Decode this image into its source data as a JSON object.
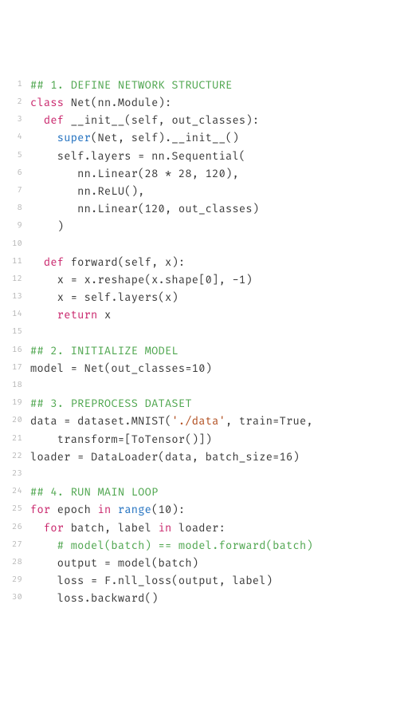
{
  "code": {
    "lines": [
      {
        "num": "1",
        "tokens": [
          {
            "cls": "tok-comment",
            "t": "## 1. DEFINE NETWORK STRUCTURE"
          }
        ]
      },
      {
        "num": "2",
        "tokens": [
          {
            "cls": "tok-keyword",
            "t": "class"
          },
          {
            "cls": "tok-plain",
            "t": " Net(nn.Module):"
          }
        ]
      },
      {
        "num": "3",
        "tokens": [
          {
            "cls": "tok-plain",
            "t": "  "
          },
          {
            "cls": "tok-keyword",
            "t": "def"
          },
          {
            "cls": "tok-plain",
            "t": " __init__(self, out_classes):"
          }
        ]
      },
      {
        "num": "4",
        "tokens": [
          {
            "cls": "tok-plain",
            "t": "    "
          },
          {
            "cls": "tok-builtin",
            "t": "super"
          },
          {
            "cls": "tok-plain",
            "t": "(Net, self).__init__()"
          }
        ]
      },
      {
        "num": "5",
        "tokens": [
          {
            "cls": "tok-plain",
            "t": "    self.layers = nn.Sequential("
          }
        ]
      },
      {
        "num": "6",
        "tokens": [
          {
            "cls": "tok-plain",
            "t": "       nn.Linear(28 * 28, 120),"
          }
        ]
      },
      {
        "num": "7",
        "tokens": [
          {
            "cls": "tok-plain",
            "t": "       nn.ReLU(),"
          }
        ]
      },
      {
        "num": "8",
        "tokens": [
          {
            "cls": "tok-plain",
            "t": "       nn.Linear(120, out_classes)"
          }
        ]
      },
      {
        "num": "9",
        "tokens": [
          {
            "cls": "tok-plain",
            "t": "    )"
          }
        ]
      },
      {
        "num": "10",
        "tokens": [
          {
            "cls": "tok-plain",
            "t": ""
          }
        ]
      },
      {
        "num": "11",
        "tokens": [
          {
            "cls": "tok-plain",
            "t": "  "
          },
          {
            "cls": "tok-keyword",
            "t": "def"
          },
          {
            "cls": "tok-plain",
            "t": " forward(self, x):"
          }
        ]
      },
      {
        "num": "12",
        "tokens": [
          {
            "cls": "tok-plain",
            "t": "    x = x.reshape(x.shape[0], -1)"
          }
        ]
      },
      {
        "num": "13",
        "tokens": [
          {
            "cls": "tok-plain",
            "t": "    x = self.layers(x)"
          }
        ]
      },
      {
        "num": "14",
        "tokens": [
          {
            "cls": "tok-plain",
            "t": "    "
          },
          {
            "cls": "tok-keyword",
            "t": "return"
          },
          {
            "cls": "tok-plain",
            "t": " x"
          }
        ]
      },
      {
        "num": "15",
        "tokens": [
          {
            "cls": "tok-plain",
            "t": ""
          }
        ]
      },
      {
        "num": "16",
        "tokens": [
          {
            "cls": "tok-comment",
            "t": "## 2. INITIALIZE MODEL"
          }
        ]
      },
      {
        "num": "17",
        "tokens": [
          {
            "cls": "tok-plain",
            "t": "model = Net(out_classes=10)"
          }
        ]
      },
      {
        "num": "18",
        "tokens": [
          {
            "cls": "tok-plain",
            "t": ""
          }
        ]
      },
      {
        "num": "19",
        "tokens": [
          {
            "cls": "tok-comment",
            "t": "## 3. PREPROCESS DATASET"
          }
        ]
      },
      {
        "num": "20",
        "tokens": [
          {
            "cls": "tok-plain",
            "t": "data = dataset.MNIST("
          },
          {
            "cls": "tok-string",
            "t": "'./data'"
          },
          {
            "cls": "tok-plain",
            "t": ", train=True,"
          }
        ]
      },
      {
        "num": "21",
        "tokens": [
          {
            "cls": "tok-plain",
            "t": "    transform=[ToTensor()])"
          }
        ]
      },
      {
        "num": "22",
        "tokens": [
          {
            "cls": "tok-plain",
            "t": "loader = DataLoader(data, batch_size=16)"
          }
        ]
      },
      {
        "num": "23",
        "tokens": [
          {
            "cls": "tok-plain",
            "t": ""
          }
        ]
      },
      {
        "num": "24",
        "tokens": [
          {
            "cls": "tok-comment",
            "t": "## 4. RUN MAIN LOOP"
          }
        ]
      },
      {
        "num": "25",
        "tokens": [
          {
            "cls": "tok-keyword",
            "t": "for"
          },
          {
            "cls": "tok-plain",
            "t": " epoch "
          },
          {
            "cls": "tok-keyword",
            "t": "in"
          },
          {
            "cls": "tok-plain",
            "t": " "
          },
          {
            "cls": "tok-builtin",
            "t": "range"
          },
          {
            "cls": "tok-plain",
            "t": "(10):"
          }
        ]
      },
      {
        "num": "26",
        "tokens": [
          {
            "cls": "tok-plain",
            "t": "  "
          },
          {
            "cls": "tok-keyword",
            "t": "for"
          },
          {
            "cls": "tok-plain",
            "t": " batch, label "
          },
          {
            "cls": "tok-keyword",
            "t": "in"
          },
          {
            "cls": "tok-plain",
            "t": " loader:"
          }
        ]
      },
      {
        "num": "27",
        "tokens": [
          {
            "cls": "tok-plain",
            "t": "    "
          },
          {
            "cls": "tok-comment",
            "t": "# model(batch) == model.forward(batch)"
          }
        ]
      },
      {
        "num": "28",
        "tokens": [
          {
            "cls": "tok-plain",
            "t": "    output = model(batch)"
          }
        ]
      },
      {
        "num": "29",
        "tokens": [
          {
            "cls": "tok-plain",
            "t": "    loss = F.nll_loss(output, label)"
          }
        ]
      },
      {
        "num": "30",
        "tokens": [
          {
            "cls": "tok-plain",
            "t": "    loss.backward()"
          }
        ]
      }
    ]
  }
}
